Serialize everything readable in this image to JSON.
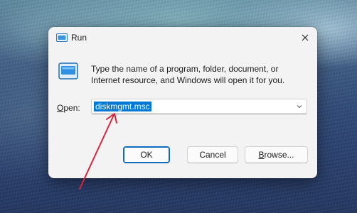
{
  "dialog": {
    "title": "Run",
    "description": "Type the name of a program, folder, document, or Internet resource, and Windows will open it for you.",
    "open_label_mnemonic": "O",
    "open_label_rest": "pen:",
    "open_value": "diskmgmt.msc",
    "buttons": {
      "ok": "OK",
      "cancel": "Cancel",
      "browse_mnemonic": "B",
      "browse_rest": "rowse..."
    }
  },
  "icons": {
    "title": "run-app-icon",
    "close": "close-icon",
    "app": "run-app-icon",
    "dropdown": "chevron-down-icon",
    "annotation": "red-arrow-annotation"
  },
  "colors": {
    "accent": "#0078d4",
    "annotation": "#d7263d",
    "dialog_bg": "#f3f3f3"
  }
}
